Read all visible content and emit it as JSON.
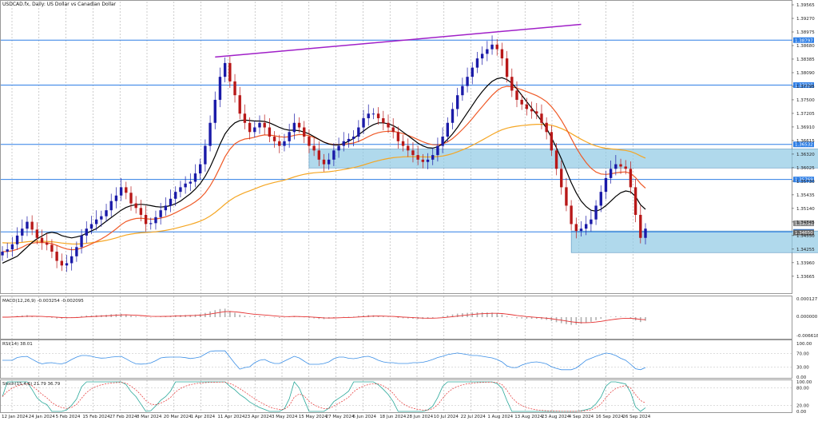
{
  "chart_data": {
    "type": "candlestick",
    "title": "USDCAD.fx, Daily:  US Dollar vs Canadian Dollar",
    "colors": {
      "up": "#1a1aa8",
      "down": "#b81818",
      "sma_short": "#000000",
      "ema_mid": "#ef5a28",
      "sma_long": "#f5a623",
      "support_line": "#2f7fe6",
      "zone": "#8ec9e4",
      "trendline": "#a020c8",
      "grid": "#9a9a9a",
      "macd_signal": "#e53030",
      "rsi": "#3a8ee6",
      "stoch_main": "#2aa89a",
      "stoch_signal": "#e53030"
    },
    "y_ticks": [
      "1.39565",
      "1.39270",
      "1.38975",
      "1.38680",
      "1.38385",
      "1.38090",
      "1.37795",
      "1.37500",
      "1.37205",
      "1.36910",
      "1.36615",
      "1.36320",
      "1.36025",
      "1.35730",
      "1.35435",
      "1.35140",
      "1.34845",
      "1.34550",
      "1.34255",
      "1.33960",
      "1.33665"
    ],
    "ylim": [
      1.3335,
      1.396
    ],
    "x_ticks": [
      "12 Jan 2024",
      "24 Jan 2024",
      "5 Feb 2024",
      "15 Feb 2024",
      "27 Feb 2024",
      "8 Mar 2024",
      "20 Mar 2024",
      "1 Apr 2024",
      "11 Apr 2024",
      "23 Apr 2024",
      "3 May 2024",
      "15 May 2024",
      "27 May 2024",
      "6 Jun 2024",
      "18 Jun 2024",
      "28 Jun 2024",
      "10 Jul 2024",
      "22 Jul 2024",
      "1 Aug 2024",
      "13 Aug 2024",
      "23 Aug 2024",
      "4 Sep 2024",
      "16 Sep 2024",
      "26 Sep 2024"
    ],
    "price_levels": [
      {
        "label": "1.38797",
        "value": 1.38797
      },
      {
        "label": "1.37820",
        "value": 1.3782
      },
      {
        "label": "1.36532",
        "value": 1.36532
      },
      {
        "label": "1.35769",
        "value": 1.35769
      },
      {
        "label": "1.34630",
        "value": 1.3463
      }
    ],
    "current_price_labels": [
      "1.34781",
      "1.34650"
    ],
    "zones": [
      {
        "from_index": 62,
        "to_index": 160,
        "low": 1.3602,
        "high": 1.3643
      },
      {
        "from_index": 115,
        "to_index": 160,
        "low": 1.3418,
        "high": 1.3465
      }
    ],
    "trendline": {
      "from_index": 43,
      "from_value": 1.3843,
      "to_index": 117,
      "to_value": 1.3914
    },
    "macd": {
      "label": "MACD(12,26,9) -0.003254 -0.002095",
      "y_ticks": [
        "0.000127",
        "0.000000",
        "-0.006618"
      ]
    },
    "rsi": {
      "label": "RSI(14) 38.01",
      "y_ticks": [
        "100.00",
        "70.00",
        "30.00",
        "0.00"
      ]
    },
    "stoch": {
      "label": "Stoch(15,4,6) 21.79 36.79",
      "y_ticks": [
        "100.00",
        "80.00",
        "20.00",
        "0.00"
      ]
    },
    "closes": [
      1.342,
      1.3425,
      1.3436,
      1.3455,
      1.347,
      1.3485,
      1.3468,
      1.345,
      1.344,
      1.3435,
      1.342,
      1.34,
      1.339,
      1.3395,
      1.341,
      1.343,
      1.3455,
      1.347,
      1.348,
      1.349,
      1.3497,
      1.351,
      1.353,
      1.3542,
      1.356,
      1.3548,
      1.3525,
      1.3515,
      1.35,
      1.348,
      1.3482,
      1.3495,
      1.351,
      1.352,
      1.3535,
      1.355,
      1.356,
      1.3568,
      1.3572,
      1.359,
      1.361,
      1.365,
      1.37,
      1.375,
      1.38,
      1.383,
      1.379,
      1.376,
      1.372,
      1.37,
      1.368,
      1.369,
      1.37,
      1.369,
      1.367,
      1.366,
      1.365,
      1.366,
      1.368,
      1.37,
      1.369,
      1.367,
      1.365,
      1.364,
      1.362,
      1.361,
      1.362,
      1.364,
      1.365,
      1.366,
      1.3665,
      1.367,
      1.369,
      1.371,
      1.372,
      1.372,
      1.371,
      1.37,
      1.369,
      1.368,
      1.366,
      1.365,
      1.364,
      1.363,
      1.362,
      1.3615,
      1.362,
      1.363,
      1.365,
      1.367,
      1.37,
      1.373,
      1.376,
      1.378,
      1.38,
      1.382,
      1.384,
      1.385,
      1.386,
      1.387,
      1.386,
      1.384,
      1.38,
      1.377,
      1.375,
      1.374,
      1.373,
      1.3725,
      1.372,
      1.37,
      1.368,
      1.364,
      1.36,
      1.356,
      1.352,
      1.348,
      1.3465,
      1.347,
      1.348,
      1.349,
      1.352,
      1.355,
      1.358,
      1.36,
      1.361,
      1.3605,
      1.36,
      1.356,
      1.35,
      1.345,
      1.347
    ],
    "sma_short": [
      1.3395,
      1.34,
      1.3405,
      1.341,
      1.342,
      1.343,
      1.344,
      1.3448,
      1.3454,
      1.346,
      1.3462,
      1.346,
      1.3455,
      1.3452,
      1.345,
      1.3452,
      1.3455,
      1.346,
      1.3465,
      1.347,
      1.3478,
      1.3486,
      1.3494,
      1.3502,
      1.351,
      1.3516,
      1.352,
      1.3522,
      1.3523,
      1.3522,
      1.352,
      1.3518,
      1.3517,
      1.3518,
      1.352,
      1.3524,
      1.353,
      1.3538,
      1.3546,
      1.3556,
      1.3568,
      1.3584,
      1.3604,
      1.3628,
      1.3654,
      1.3676,
      1.369,
      1.37,
      1.3705,
      1.3706,
      1.3705,
      1.3704,
      1.3704,
      1.3703,
      1.37,
      1.3695,
      1.369,
      1.3686,
      1.3684,
      1.3684,
      1.3683,
      1.368,
      1.3676,
      1.367,
      1.3664,
      1.3658,
      1.3654,
      1.3652,
      1.3652,
      1.3655,
      1.366,
      1.3666,
      1.3674,
      1.3682,
      1.369,
      1.3696,
      1.37,
      1.37,
      1.3698,
      1.3694,
      1.3688,
      1.368,
      1.3672,
      1.3664,
      1.3656,
      1.365,
      1.3646,
      1.3645,
      1.3648,
      1.3654,
      1.3664,
      1.3676,
      1.369,
      1.3706,
      1.3722,
      1.3738,
      1.3754,
      1.3768,
      1.378,
      1.379,
      1.3796,
      1.3798,
      1.3794,
      1.3786,
      1.3774,
      1.376,
      1.3746,
      1.3732,
      1.3718,
      1.3704,
      1.3688,
      1.3668,
      1.3646,
      1.3622,
      1.3596,
      1.357,
      1.3548,
      1.353,
      1.3518,
      1.351,
      1.3508,
      1.3512,
      1.352,
      1.353,
      1.354,
      1.3548,
      1.3552,
      1.355,
      1.354,
      1.3522,
      1.3512
    ]
  }
}
